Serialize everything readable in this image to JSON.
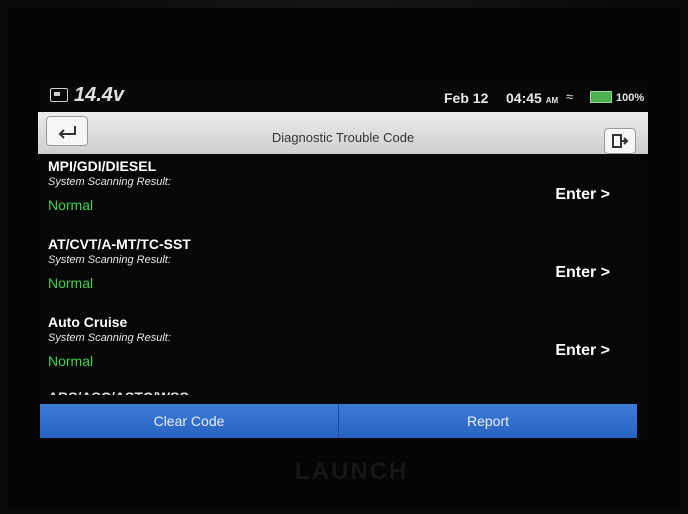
{
  "status": {
    "voltage": "14.4v",
    "date": "Feb 12",
    "time": "04:45",
    "ampm": "AM",
    "battery": "100%",
    "wifi_icon": "wifi-icon"
  },
  "header": {
    "title": "Diagnostic Trouble Code"
  },
  "items": [
    {
      "name": "MPI/GDI/DIESEL",
      "subtitle": "System Scanning Result:",
      "status": "Normal",
      "action": "Enter >"
    },
    {
      "name": "AT/CVT/A-MT/TC-SST",
      "subtitle": "System Scanning Result:",
      "status": "Normal",
      "action": "Enter >"
    },
    {
      "name": "Auto Cruise",
      "subtitle": "System Scanning Result:",
      "status": "Normal",
      "action": "Enter >"
    }
  ],
  "partial_item": "ABS/ASC/ASTC/WSS",
  "buttons": {
    "clear": "Clear Code",
    "report": "Report"
  },
  "device_logo": "LAUNCH",
  "colors": {
    "normal": "#3fd44b",
    "button": "#2f6ccc"
  }
}
